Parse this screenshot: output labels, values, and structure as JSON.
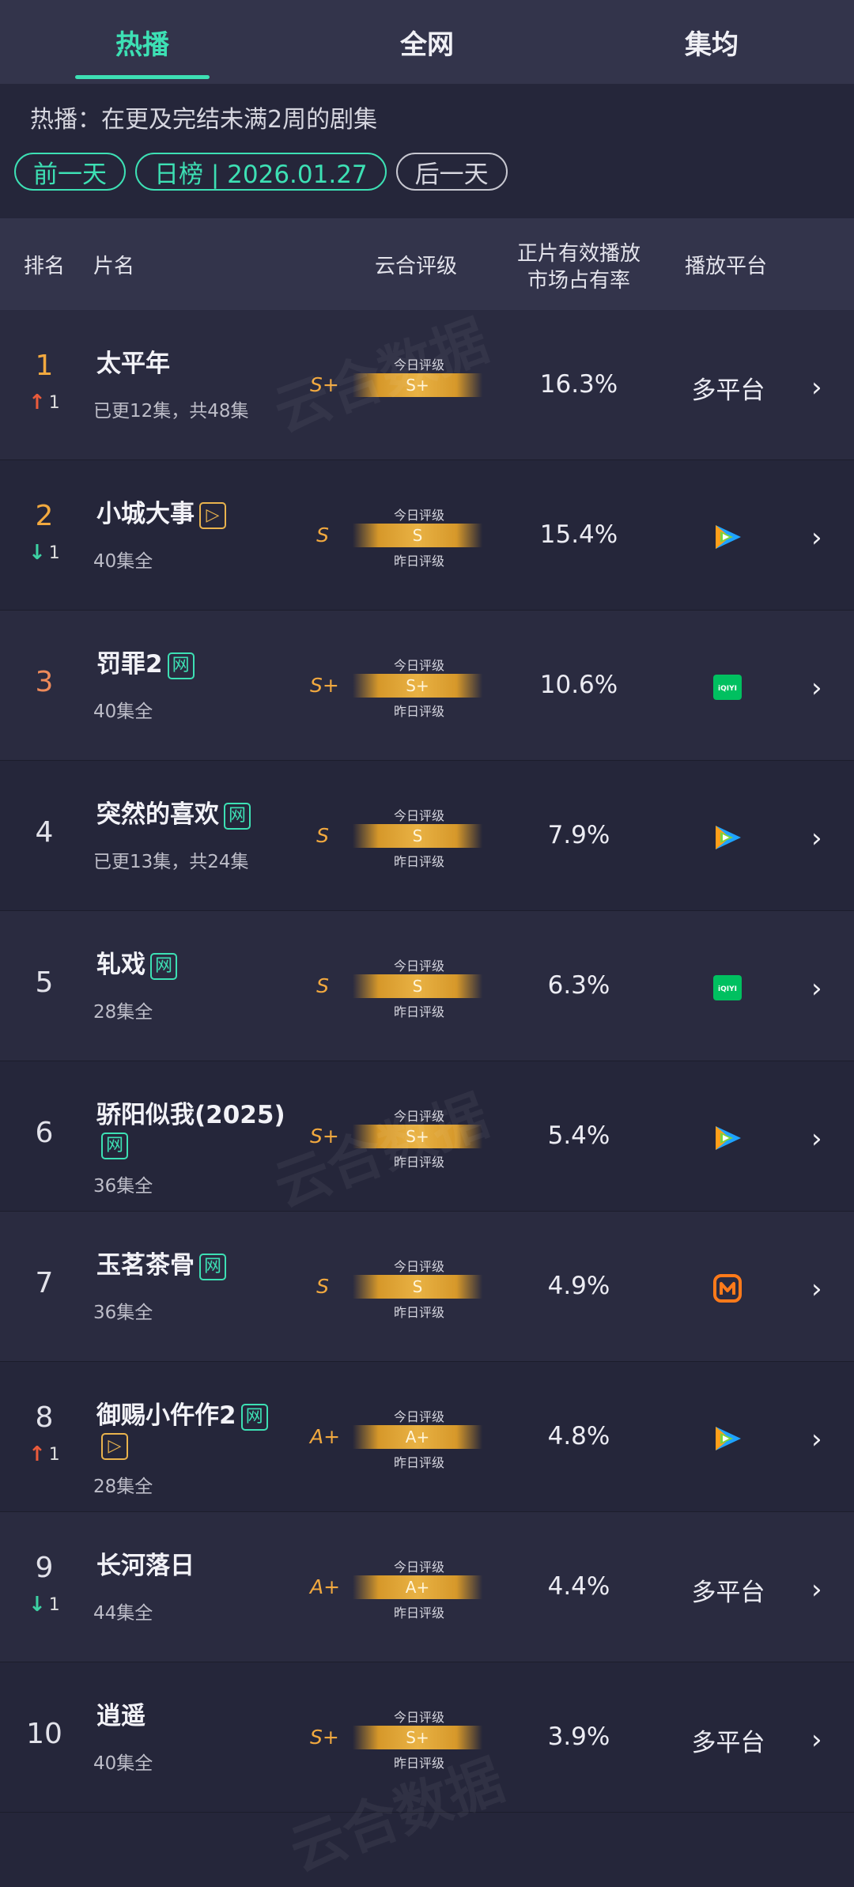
{
  "tabs": [
    "热播",
    "全网",
    "集均"
  ],
  "description": "热播：在更及完结未满2周的剧集",
  "pills": {
    "prev": "前一天",
    "date": "日榜 | 2026.01.27",
    "next": "后一天"
  },
  "table_header": {
    "rank": "排名",
    "title": "片名",
    "grade": "云合评级",
    "share_line1": "正片有效播放",
    "share_line2": "市场占有率",
    "platform": "播放平台"
  },
  "grade_labels": {
    "today": "今日评级",
    "yesterday": "昨日评级"
  },
  "tag_labels": {
    "net": "网",
    "vip": "▷"
  },
  "chevron": "›",
  "watermark": "云合数据",
  "rows": [
    {
      "rank": "1",
      "change": "1",
      "change_dir": "up",
      "title": "太平年",
      "sub": "已更12集，共48集",
      "grade_yest": "S+",
      "grade_today": "S+",
      "share": "16.3%",
      "platform": "多平台",
      "platform_icon": "multi-text",
      "tags": []
    },
    {
      "rank": "2",
      "change": "1",
      "change_dir": "down",
      "title": "小城大事",
      "sub": "40集全",
      "grade_yest": "S",
      "grade_today": "S",
      "share": "15.4%",
      "platform": "",
      "platform_icon": "tencent-video-icon",
      "tags": [
        "vip"
      ]
    },
    {
      "rank": "3",
      "change": "",
      "change_dir": "",
      "title": "罚罪2",
      "sub": "40集全",
      "grade_yest": "S+",
      "grade_today": "S+",
      "share": "10.6%",
      "platform": "",
      "platform_icon": "iqiyi-icon",
      "tags": [
        "net"
      ]
    },
    {
      "rank": "4",
      "change": "",
      "change_dir": "",
      "title": "突然的喜欢",
      "sub": "已更13集，共24集",
      "grade_yest": "S",
      "grade_today": "S",
      "share": "7.9%",
      "platform": "",
      "platform_icon": "tencent-video-icon",
      "tags": [
        "net"
      ]
    },
    {
      "rank": "5",
      "change": "",
      "change_dir": "",
      "title": "轧戏",
      "sub": "28集全",
      "grade_yest": "S",
      "grade_today": "S",
      "share": "6.3%",
      "platform": "",
      "platform_icon": "iqiyi-icon",
      "tags": [
        "net"
      ]
    },
    {
      "rank": "6",
      "change": "",
      "change_dir": "",
      "title": "骄阳似我(2025)",
      "sub": "36集全",
      "grade_yest": "S+",
      "grade_today": "S+",
      "share": "5.4%",
      "platform": "",
      "platform_icon": "tencent-video-icon",
      "tags": [
        "net"
      ]
    },
    {
      "rank": "7",
      "change": "",
      "change_dir": "",
      "title": "玉茗茶骨",
      "sub": "36集全",
      "grade_yest": "S",
      "grade_today": "S",
      "share": "4.9%",
      "platform": "",
      "platform_icon": "mango-tv-icon",
      "tags": [
        "net"
      ]
    },
    {
      "rank": "8",
      "change": "1",
      "change_dir": "up",
      "title": "御赐小仵作2",
      "sub": "28集全",
      "grade_yest": "A+",
      "grade_today": "A+",
      "share": "4.8%",
      "platform": "",
      "platform_icon": "tencent-video-icon",
      "tags": [
        "net",
        "vip"
      ]
    },
    {
      "rank": "9",
      "change": "1",
      "change_dir": "down",
      "title": "长河落日",
      "sub": "44集全",
      "grade_yest": "A+",
      "grade_today": "A+",
      "share": "4.4%",
      "platform": "多平台",
      "platform_icon": "multi-text",
      "tags": []
    },
    {
      "rank": "10",
      "change": "",
      "change_dir": "",
      "title": "逍遥",
      "sub": "40集全",
      "grade_yest": "S+",
      "grade_today": "S+",
      "share": "3.9%",
      "platform": "多平台",
      "platform_icon": "multi-text",
      "tags": []
    }
  ]
}
